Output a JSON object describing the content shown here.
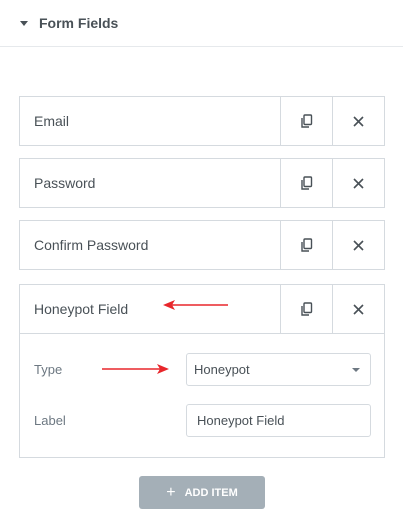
{
  "section": {
    "title": "Form Fields"
  },
  "items": [
    {
      "label": "Email"
    },
    {
      "label": "Password"
    },
    {
      "label": "Confirm Password"
    },
    {
      "label": "Honeypot Field"
    }
  ],
  "active_item": {
    "type_label": "Type",
    "type_value": "Honeypot",
    "field_label": "Label",
    "field_value": "Honeypot Field"
  },
  "add_button": {
    "label": "ADD ITEM",
    "icon": "plus-icon"
  },
  "icons": {
    "duplicate": "duplicate-icon",
    "remove": "close-icon",
    "toggle": "caret-down-icon"
  },
  "colors": {
    "annotation_arrow": "#e8262b",
    "add_button_bg": "#a4afb7",
    "border": "#d5dadf"
  }
}
